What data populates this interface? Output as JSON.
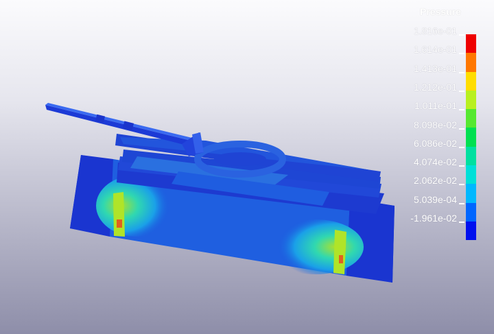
{
  "legend": {
    "title": "Pressure",
    "labels": [
      "1.816e-01",
      "1.614e-01",
      "1.413e-01",
      "1.212e-01",
      "1.011e-01",
      "8.098e-02",
      "6.086e-02",
      "4.074e-02",
      "2.062e-02",
      "5.039e-04",
      "-1.961e-02"
    ],
    "colors": [
      "#ee0000",
      "#ff7700",
      "#ffdd00",
      "#b8f020",
      "#55e830",
      "#00e050",
      "#00e0a0",
      "#00e0d8",
      "#00b8ff",
      "#0066ff",
      "#0010ee"
    ]
  }
}
